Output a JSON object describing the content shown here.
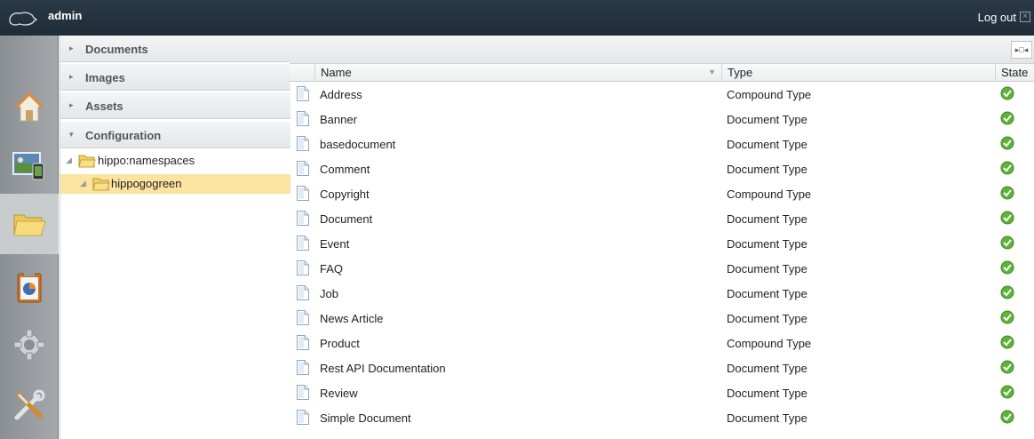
{
  "header": {
    "username": "admin",
    "logout_label": "Log out",
    "logout_icon": "close-box-icon"
  },
  "app_nav": [
    {
      "icon": "home-icon"
    },
    {
      "icon": "channel-manager-icon"
    },
    {
      "icon": "folder-icon",
      "active": true
    },
    {
      "icon": "reports-clipboard-icon"
    },
    {
      "icon": "gear-icon"
    },
    {
      "icon": "tools-icon"
    }
  ],
  "accordion": {
    "sections": [
      {
        "label": "Documents",
        "expanded": false
      },
      {
        "label": "Images",
        "expanded": false
      },
      {
        "label": "Assets",
        "expanded": false
      },
      {
        "label": "Configuration",
        "expanded": true
      }
    ],
    "tree": [
      {
        "label": "hippo:namespaces",
        "level": 0,
        "selected": false
      },
      {
        "label": "hippogogreen",
        "level": 1,
        "selected": true
      }
    ]
  },
  "table": {
    "columns": {
      "name": "Name",
      "type": "Type",
      "state": "State"
    },
    "rows": [
      {
        "name": "Address",
        "type": "Compound Type",
        "state": "ok"
      },
      {
        "name": "Banner",
        "type": "Document Type",
        "state": "ok"
      },
      {
        "name": "basedocument",
        "type": "Document Type",
        "state": "ok"
      },
      {
        "name": "Comment",
        "type": "Document Type",
        "state": "ok"
      },
      {
        "name": "Copyright",
        "type": "Compound Type",
        "state": "ok"
      },
      {
        "name": "Document",
        "type": "Document Type",
        "state": "ok"
      },
      {
        "name": "Event",
        "type": "Document Type",
        "state": "ok"
      },
      {
        "name": "FAQ",
        "type": "Document Type",
        "state": "ok"
      },
      {
        "name": "Job",
        "type": "Document Type",
        "state": "ok"
      },
      {
        "name": "News Article",
        "type": "Document Type",
        "state": "ok"
      },
      {
        "name": "Product",
        "type": "Compound Type",
        "state": "ok"
      },
      {
        "name": "Rest API Documentation",
        "type": "Document Type",
        "state": "ok"
      },
      {
        "name": "Review",
        "type": "Document Type",
        "state": "ok"
      },
      {
        "name": "Simple Document",
        "type": "Document Type",
        "state": "ok"
      }
    ]
  },
  "colors": {
    "topbar": "#1f2c38",
    "selected_tree": "#fbe3a0",
    "state_ok": "#5cb338"
  }
}
